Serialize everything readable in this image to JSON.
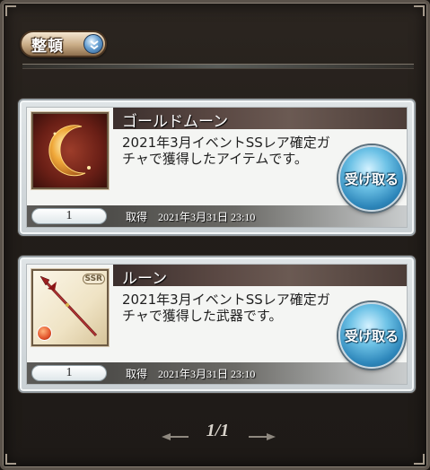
{
  "toolbar": {
    "sort_label": "整頓"
  },
  "items": [
    {
      "name": "ゴールドムーン",
      "description": "2021年3月イベントSSレア確定ガチャで獲得したアイテムです。",
      "quantity": "1",
      "obtained_label": "取得",
      "obtained_date": "2021年3月31日 23:10",
      "receive_label": "受け取る",
      "icon": "gold-moon-icon"
    },
    {
      "name": "ルーン",
      "description": "2021年3月イベントSSレア確定ガチャで獲得した武器です。",
      "quantity": "1",
      "obtained_label": "取得",
      "obtained_date": "2021年3月31日 23:10",
      "receive_label": "受け取る",
      "icon": "spear-weapon-icon",
      "rarity_badge": "SSR"
    }
  ],
  "pager": {
    "text": "1/1"
  }
}
